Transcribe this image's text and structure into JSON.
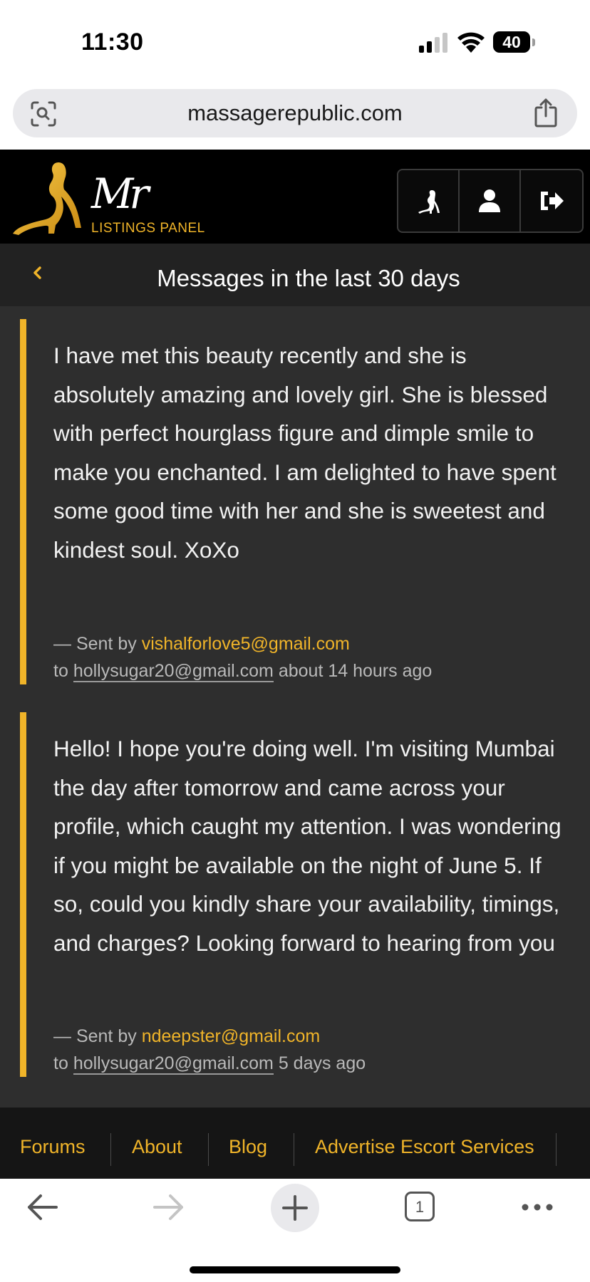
{
  "status_bar": {
    "time": "11:30",
    "battery": "40"
  },
  "browser": {
    "url": "massagerepublic.com",
    "tab_count": "1"
  },
  "header": {
    "logo_mark": "Mr",
    "logo_subtitle": "LISTINGS PANEL",
    "icons": [
      "figure-icon",
      "user-icon",
      "logout-icon"
    ]
  },
  "page": {
    "title": "Messages in the last 30 days"
  },
  "messages": [
    {
      "body": "I have met this beauty recently and she is absolutely amazing and lovely girl. She is blessed with perfect hourglass figure and dimple smile to make you enchanted. I am delighted to have spent some good time with her and she is sweetest and kindest soul. XoXo",
      "sent_by_label": "— Sent by",
      "sender": "vishalforlove5@gmail.com",
      "to_label": "to",
      "recipient": "hollysugar20@gmail.com",
      "time": "about 14 hours ago"
    },
    {
      "body": "Hello! I hope you're doing well. I'm visiting Mumbai the day after tomorrow and came across your profile, which caught my attention. I was wondering if you might be available on the night of June 5. If so, could you kindly share your availability, timings, and charges? Looking forward to hearing from you",
      "sent_by_label": "— Sent by",
      "sender": "ndeepster@gmail.com",
      "to_label": "to",
      "recipient": "hollysugar20@gmail.com",
      "time": "5 days ago"
    }
  ],
  "footer": {
    "links": [
      "Forums",
      "About",
      "Blog",
      "Advertise Escort Services"
    ]
  },
  "colors": {
    "accent": "#f0b429",
    "header_bg": "#000000",
    "content_bg": "#2e2e2e",
    "title_bar_bg": "#222222"
  }
}
